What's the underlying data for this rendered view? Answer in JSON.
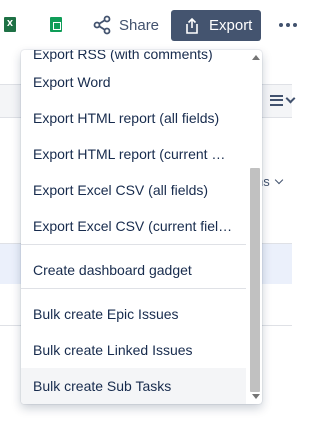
{
  "toolbar": {
    "excel_icon_glyph": "X",
    "share_label": "Share",
    "export_label": "Export"
  },
  "background": {
    "columns_label_fragment": "ns"
  },
  "menu": {
    "items": [
      {
        "label": "Export RSS (with comments)"
      },
      {
        "label": "Export Word"
      },
      {
        "label": "Export HTML report (all fields)"
      },
      {
        "label": "Export HTML report (current …"
      },
      {
        "label": "Export Excel CSV (all fields)"
      },
      {
        "label": "Export Excel CSV (current fiel…"
      },
      {
        "label": "Create dashboard gadget"
      },
      {
        "label": "Bulk create Epic Issues"
      },
      {
        "label": "Bulk create Linked Issues"
      },
      {
        "label": "Bulk create Sub Tasks"
      }
    ],
    "hovered_index": 9
  },
  "colors": {
    "export_button_bg": "#44546f",
    "text": "#172b4d",
    "excel_green": "#1e7145",
    "sheets_green": "#0f9d58",
    "highlight_row": "#ebf0fb"
  }
}
